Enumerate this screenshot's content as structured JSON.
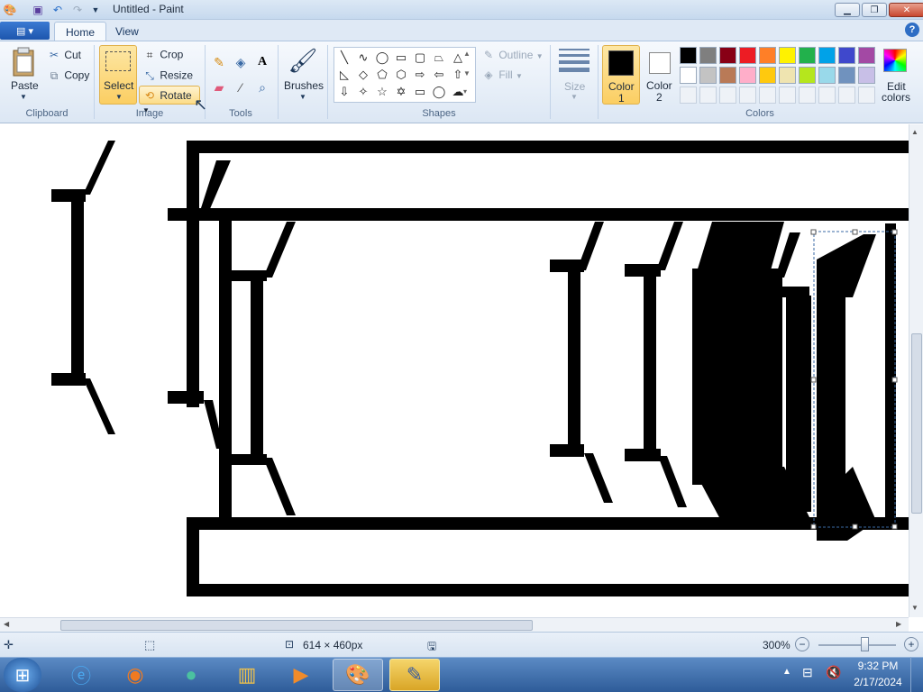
{
  "window": {
    "title": "Untitled - Paint"
  },
  "tabs": {
    "home": "Home",
    "view": "View"
  },
  "clipboard": {
    "paste": "Paste",
    "cut": "Cut",
    "copy": "Copy",
    "group": "Clipboard"
  },
  "image": {
    "select": "Select",
    "crop": "Crop",
    "resize": "Resize",
    "rotate": "Rotate",
    "group": "Image"
  },
  "tools": {
    "group": "Tools",
    "text_tool": "A"
  },
  "brushes": {
    "label": "Brushes"
  },
  "shapes": {
    "group": "Shapes",
    "outline": "Outline",
    "fill": "Fill"
  },
  "size": {
    "label": "Size"
  },
  "colors": {
    "color1": "Color\n1",
    "color1_a": "Color",
    "color1_b": "1",
    "color2_a": "Color",
    "color2_b": "2",
    "edit_a": "Edit",
    "edit_b": "colors",
    "group": "Colors",
    "palette_row1": [
      "#000000",
      "#7f7f7f",
      "#880015",
      "#ed1c24",
      "#ff7f27",
      "#fff200",
      "#22b14c",
      "#00a2e8",
      "#3f48cc",
      "#a349a4"
    ],
    "palette_row2": [
      "#ffffff",
      "#c3c3c3",
      "#b97a57",
      "#ffaec9",
      "#ffc90e",
      "#efe4b0",
      "#b5e61d",
      "#99d9ea",
      "#7092be",
      "#c8bfe7"
    ]
  },
  "status": {
    "dimensions": "614 × 460px",
    "zoom": "300%"
  },
  "clock": {
    "time": "9:32 PM",
    "date": "2/17/2024"
  }
}
